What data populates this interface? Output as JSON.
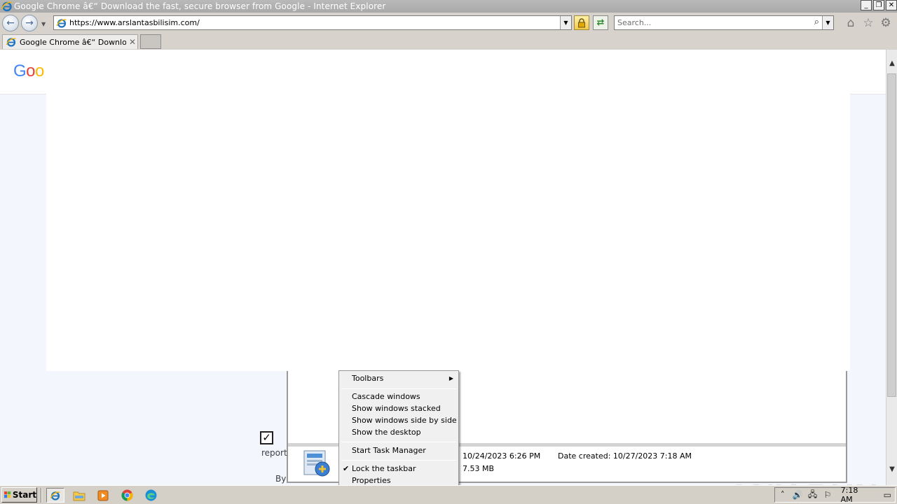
{
  "window": {
    "title": "Google Chrome â€“ Download the fast, secure browser from Google - Internet Explorer",
    "controls": [
      "minimize",
      "restore",
      "close"
    ]
  },
  "navbar": {
    "url": "https://www.arslantasbilisim.com/",
    "search_placeholder": "Search..."
  },
  "tabs": [
    {
      "title": "Google Chrome â€“ Downloa...",
      "active": true
    }
  ],
  "page": {
    "logo_text": "Goo",
    "report_label": "report",
    "by_label": "By",
    "download_info": {
      "date_modified": "10/24/2023 6:26 PM",
      "date_created_label": "Date created:",
      "date_created": "10/27/2023 7:18 AM",
      "size": "7.53 MB"
    }
  },
  "context_menu": {
    "items": [
      {
        "label": "Toolbars",
        "has_submenu": true
      },
      {
        "label": "Cascade windows"
      },
      {
        "label": "Show windows stacked"
      },
      {
        "label": "Show windows side by side"
      },
      {
        "label": "Show the desktop"
      },
      {
        "label": "Start Task Manager"
      },
      {
        "label": "Lock the taskbar",
        "checked": true
      },
      {
        "label": "Properties"
      }
    ]
  },
  "taskbar": {
    "start_label": "Start",
    "quick_launch": [
      "internet-explorer",
      "windows-explorer",
      "media-player",
      "chrome",
      "edge"
    ],
    "clock": "7:18 AM"
  },
  "watermark": "ANY RUN",
  "colors": {
    "google_blue": "#4285f4",
    "google_red": "#ea4335",
    "google_yellow": "#fbbc05",
    "titlebar": "#b0b0b0",
    "taskbar": "#d4d0c8"
  }
}
